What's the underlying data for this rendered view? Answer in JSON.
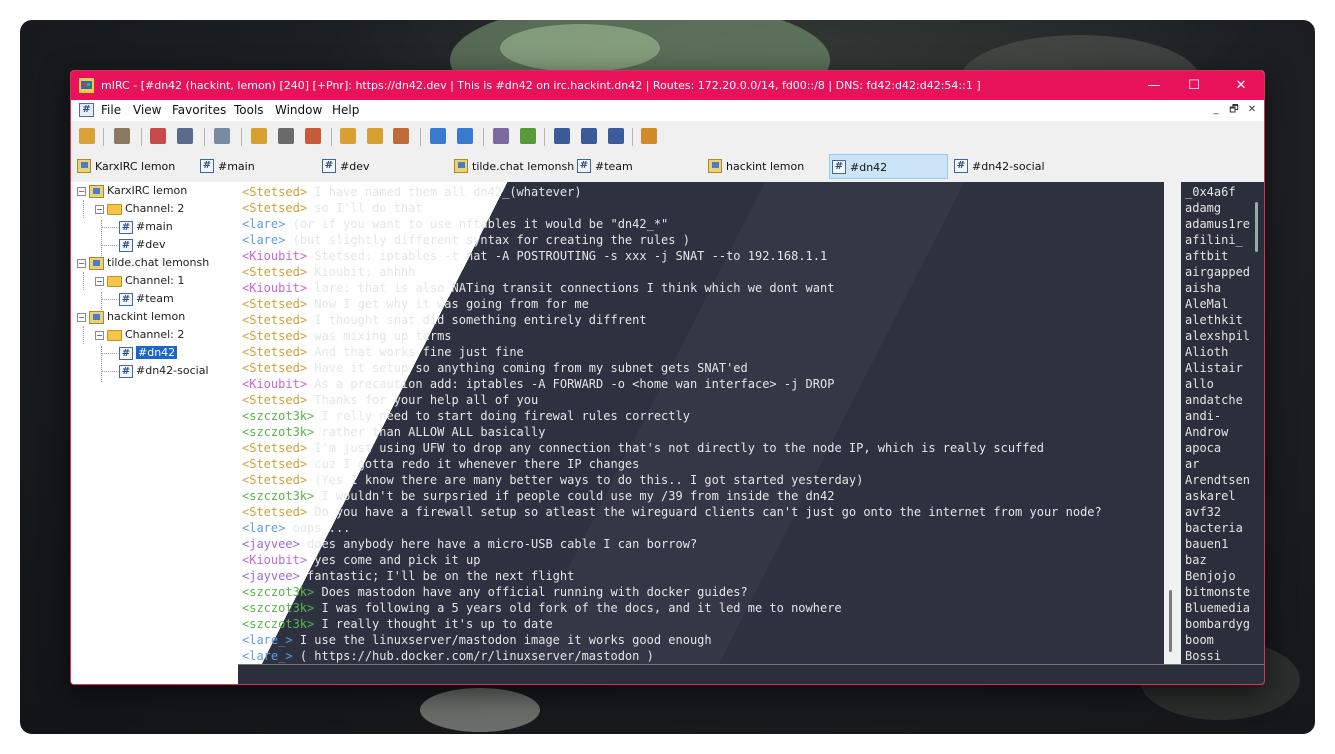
{
  "window": {
    "title": "mIRC - [#dn42 (hackint, lemon) [240] [+Pnr]: https://dn42.dev | This is #dn42 on irc.hackint.dn42 | Routes: 172.20.0.0/14, fd00::/8 | DNS: fd42:d42:d42:54::1 ]",
    "controls": {
      "minimize": "—",
      "maximize": "☐",
      "close": "✕"
    }
  },
  "menu": {
    "icon": "#",
    "items": [
      "File",
      "View",
      "Favorites",
      "Tools",
      "Window",
      "Help"
    ],
    "mdi_controls": [
      "_",
      "🗗",
      "✕"
    ]
  },
  "toolbar": {
    "icons": [
      "connect-icon",
      "options-icon",
      "favorites-icon",
      "address-book-icon",
      "scripts-editor-icon",
      "channels-list-icon",
      "timer-icon",
      "colors-icon",
      "send-file-icon",
      "dcc-chat-icon",
      "get-file-icon",
      "notify-icon",
      "urls-icon",
      "log-icon",
      "received-icon",
      "tile-horizontal-icon",
      "tile-vertical-icon",
      "cascade-icon",
      "help-icon"
    ],
    "colors": [
      "#d9a23a",
      "#8a7a60",
      "#c84a4a",
      "#5a6a8a",
      "#7a8aa0",
      "#d8a030",
      "#6a6a6a",
      "#c85a3a",
      "#d8a030",
      "#d8a030",
      "#c06a3a",
      "#3a7ad0",
      "#3a7ad0",
      "#7a6aa0",
      "#5a9a3a",
      "#3a5a9a",
      "#3a5a9a",
      "#3a5a9a",
      "#d08a2a"
    ]
  },
  "switchbar": {
    "tabs": [
      {
        "label": "KarxIRC lemon",
        "type": "server"
      },
      {
        "label": "#main",
        "type": "channel"
      },
      {
        "label": "#dev",
        "type": "channel"
      },
      {
        "label": "tilde.chat lemonsh",
        "type": "server"
      },
      {
        "label": "#team",
        "type": "channel"
      },
      {
        "label": "hackint lemon",
        "type": "server"
      },
      {
        "label": "#dn42",
        "type": "channel",
        "active": true
      },
      {
        "label": "#dn42-social",
        "type": "channel"
      }
    ]
  },
  "tree": {
    "servers": [
      {
        "label": "KarxIRC lemon",
        "group": "Channel: 2",
        "channels": [
          "#main",
          "#dev"
        ]
      },
      {
        "label": "tilde.chat lemonsh",
        "group": "Channel: 1",
        "channels": [
          "#team"
        ]
      },
      {
        "label": "hackint lemon",
        "group": "Channel: 2",
        "channels": [
          "#dn42",
          "#dn42-social"
        ],
        "selected": "#dn42"
      }
    ],
    "expander": "−"
  },
  "chat": {
    "lines": [
      {
        "nick": "Stetsed",
        "text": "I have named them all dn42_(whatever)"
      },
      {
        "nick": "Stetsed",
        "text": "so I'll do that"
      },
      {
        "nick": "lare",
        "text": "(or if you want to use nftables it would be \"dn42_*\""
      },
      {
        "nick": "lare",
        "text": "(but slightly different syntax for creating the rules )"
      },
      {
        "nick": "Kioubit",
        "text": "Stetsed: iptables -t nat -A POSTROUTING -s xxx -j SNAT --to 192.168.1.1"
      },
      {
        "nick": "Stetsed",
        "text": "Kioubit: ahhhh"
      },
      {
        "nick": "Kioubit",
        "text": "lare: that is also NATing transit connections I think which we dont want"
      },
      {
        "nick": "Stetsed",
        "text": "Now I get why it was going from for me"
      },
      {
        "nick": "Stetsed",
        "text": "I thought snat did something entirely diffrent"
      },
      {
        "nick": "Stetsed",
        "text": "was mixing up terms"
      },
      {
        "nick": "Stetsed",
        "text": "And that works fine just fine"
      },
      {
        "nick": "Stetsed",
        "text": "Have it setup so anything coming from my subnet gets SNAT'ed"
      },
      {
        "nick": "Kioubit",
        "text": "As a precaution add: iptables -A FORWARD -o <home wan interface> -j DROP"
      },
      {
        "nick": "Stetsed",
        "text": "Thanks for your help all of you"
      },
      {
        "nick": "szczot3k",
        "text": "I relly need to start doing firewal rules correctly"
      },
      {
        "nick": "szczot3k",
        "text": "rather than ALLOW ALL basically"
      },
      {
        "nick": "Stetsed",
        "text": "I'm just using UFW to drop any connection that's not directly to the node IP, which is really scuffed"
      },
      {
        "nick": "Stetsed",
        "text": "cuz I gotta redo it whenever there IP changes"
      },
      {
        "nick": "Stetsed",
        "text": "(Yes I know there are many better ways to do this.. I got started yesterday)"
      },
      {
        "nick": "szczot3k",
        "text": "I wouldn't be surpsried if people could use my /39 from inside the dn42"
      },
      {
        "nick": "Stetsed",
        "text": "Do you have a firewall setup so atleast the wireguard clients can't just go onto the internet from your node?"
      },
      {
        "nick": "lare",
        "text": "oops ..."
      },
      {
        "nick": "jayvee",
        "text": "does anybody here have a micro-USB cable I can borrow?"
      },
      {
        "nick": "Kioubit",
        "text": "yes come and pick it up"
      },
      {
        "nick": "jayvee",
        "text": "fantastic; I'll be on the next flight"
      },
      {
        "nick": "szczot3k",
        "text": "Does mastodon have any official running with docker guides?"
      },
      {
        "nick": "szczot3k",
        "text": "I was following a 5 years old fork of the docs, and it led me to nowhere"
      },
      {
        "nick": "szczot3k",
        "text": "I really thought it's up to date"
      },
      {
        "nick": "lare_",
        "text": "I use the linuxserver/mastodon image it works good enough"
      },
      {
        "nick": "lare_",
        "text": "( https://hub.docker.com/r/linuxserver/mastodon )"
      }
    ]
  },
  "nicklist": {
    "nicks": [
      "_0x4a6f",
      "adamg",
      "adamus1re",
      "afilini_",
      "aftbit",
      "airgapped",
      "aisha",
      "AleMal",
      "alethkit",
      "alexshpil",
      "Alioth",
      "Alistair",
      "allo",
      "andatche",
      "andi-",
      "Androw",
      "apoca",
      "ar",
      "Arendtsen",
      "askarel",
      "avf32",
      "bacteria",
      "bauen1",
      "baz",
      "Benjojo",
      "bitmonste",
      "Bluemedia",
      "bombardyg",
      "boom",
      "Bossi"
    ]
  }
}
